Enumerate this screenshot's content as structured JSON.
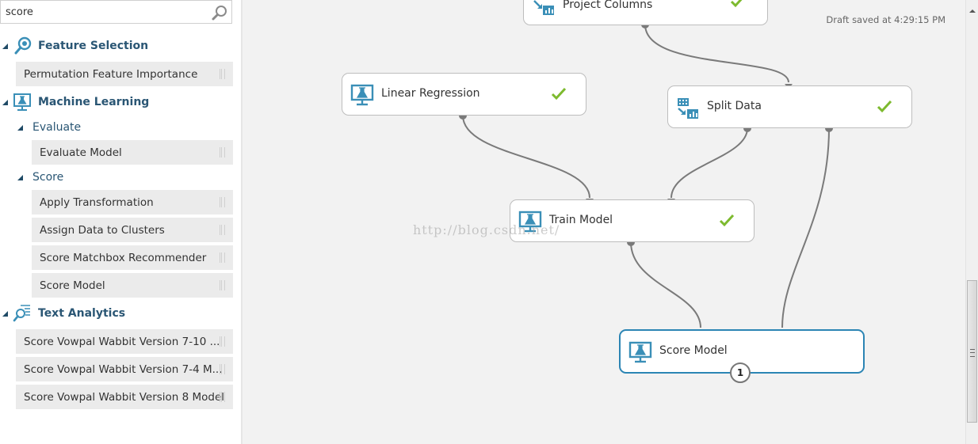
{
  "search": {
    "value": "score",
    "icon": "search-icon"
  },
  "palette": {
    "categories": [
      {
        "label": "Feature Selection",
        "icon": "feature-selection-icon",
        "items": [
          "Permutation Feature Importance"
        ]
      },
      {
        "label": "Machine Learning",
        "icon": "machine-learning-icon",
        "subcategories": [
          {
            "label": "Evaluate",
            "items": [
              "Evaluate Model"
            ]
          },
          {
            "label": "Score",
            "items": [
              "Apply Transformation",
              "Assign Data to Clusters",
              "Score Matchbox Recommender",
              "Score Model"
            ]
          }
        ]
      },
      {
        "label": "Text Analytics",
        "icon": "text-analytics-icon",
        "items": [
          "Score Vowpal Wabbit Version 7-10 ...",
          "Score Vowpal Wabbit Version 7-4 M...",
          "Score Vowpal Wabbit Version 8 Model"
        ]
      }
    ]
  },
  "canvas": {
    "draft_status": "Draft saved at 4:29:15 PM",
    "watermark": "http://blog.csdn.net/",
    "nodes": [
      {
        "id": "project-columns",
        "label": "Project Columns",
        "icon": "data-transform-icon",
        "status": "completed"
      },
      {
        "id": "linear-regression",
        "label": "Linear Regression",
        "icon": "machine-learning-icon",
        "status": "completed"
      },
      {
        "id": "split-data",
        "label": "Split Data",
        "icon": "data-transform-icon",
        "status": "completed"
      },
      {
        "id": "train-model",
        "label": "Train Model",
        "icon": "machine-learning-icon",
        "status": "completed"
      },
      {
        "id": "score-model",
        "label": "Score Model",
        "icon": "machine-learning-icon",
        "status": "selected",
        "badge": "1"
      }
    ],
    "connections": [
      {
        "from": "project-columns",
        "to": "split-data"
      },
      {
        "from": "linear-regression",
        "to": "train-model"
      },
      {
        "from": "split-data",
        "to": "train-model"
      },
      {
        "from": "train-model",
        "to": "score-model"
      },
      {
        "from": "split-data",
        "to": "score-model"
      }
    ]
  },
  "colors": {
    "accent": "#2c85b4",
    "icon": "#3a8fb7",
    "check": "#7dba2e",
    "category_text": "#2a5674",
    "wire": "#7a7a7a"
  }
}
